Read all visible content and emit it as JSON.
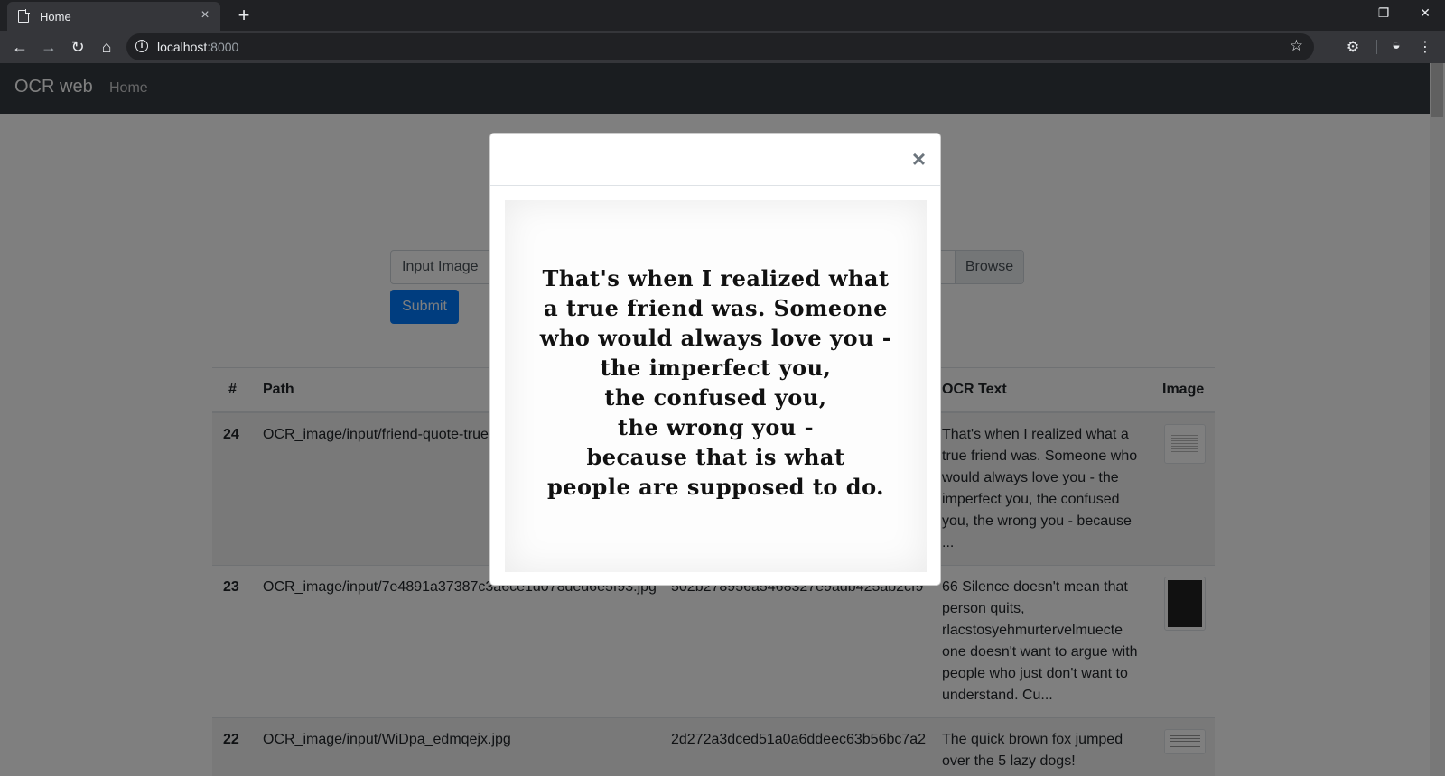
{
  "browser": {
    "tab_title": "Home",
    "tab_close": "×",
    "new_tab": "+",
    "url_host": "localhost",
    "url_port": ":8000",
    "window": {
      "minimize": "—",
      "restore": "❐",
      "close": "✕"
    }
  },
  "app": {
    "brand": "OCR web",
    "nav_home": "Home"
  },
  "form": {
    "file_placeholder": "Input Image",
    "browse_label": "Browse",
    "submit_label": "Submit"
  },
  "table": {
    "headers": {
      "num": "#",
      "path": "Path",
      "ocr": "OCR Text",
      "image": "Image"
    },
    "rows": [
      {
        "num": "24",
        "path": "OCR_image/input/friend-quote-true",
        "hash": "",
        "ocr": "That's when I realized what a true friend was. Someone who would always love you - the imperfect you, the confused you, the wrong you - because ..."
      },
      {
        "num": "23",
        "path": "OCR_image/input/7e4891a37387c3a6ce1d078ded6e5f93.jpg",
        "hash": "502b278956a5468327e9adb425ab2cf9",
        "ocr": "66 Silence doesn't mean that person quits, rlacstosyehmurtervelmuecte one doesn't want to argue with people who just don't want to understand. Cu..."
      },
      {
        "num": "22",
        "path": "OCR_image/input/WiDpa_edmqejx.jpg",
        "hash": "2d272a3dced51a0a6ddeec63b56bc7a2",
        "ocr": "The quick brown fox jumped over the 5 lazy dogs!"
      }
    ]
  },
  "modal": {
    "close_label": "×",
    "quote_lines": [
      "That's when I realized what",
      "a true friend was. Someone",
      "who would always love you -",
      "the imperfect you,",
      "the confused you,",
      "the wrong you -",
      "because that is what",
      "people are supposed to do."
    ]
  }
}
